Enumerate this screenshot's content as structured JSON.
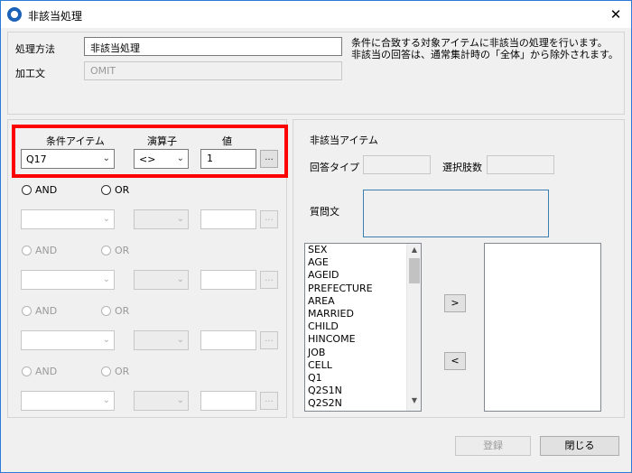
{
  "window": {
    "title": "非該当処理",
    "close_glyph": "✕"
  },
  "header": {
    "process_label": "処理方法",
    "process_value": "非該当処理",
    "kakou_label": "加工文",
    "kakou_value": "OMIT",
    "desc_line1": "条件に合致する対象アイテムに非該当の処理を行います。",
    "desc_line2": "非該当の回答は、通常集計時の「全体」から除外されます。"
  },
  "conditions": {
    "col_item": "条件アイテム",
    "col_operator": "演算子",
    "col_value": "値",
    "row1": {
      "item": "Q17",
      "operator": "<>",
      "value": "1"
    },
    "ellipsis": "...",
    "and_label": "AND",
    "or_label": "OR",
    "arrow": "⌄"
  },
  "right": {
    "section_title": "非該当アイテム",
    "answer_type_label": "回答タイプ",
    "choice_count_label": "選択肢数",
    "question_label": "質問文",
    "list_items": [
      "SEX",
      "AGE",
      "AGEID",
      "PREFECTURE",
      "AREA",
      "MARRIED",
      "CHILD",
      "HINCOME",
      "JOB",
      "CELL",
      "Q1",
      "Q2S1N",
      "Q2S2N"
    ],
    "add_button": ">",
    "remove_button": "<"
  },
  "footer": {
    "register_label": "登録",
    "close_label": "閉じる"
  },
  "colors": {
    "highlight": "#ff0000",
    "accent": "#1c63b7"
  }
}
